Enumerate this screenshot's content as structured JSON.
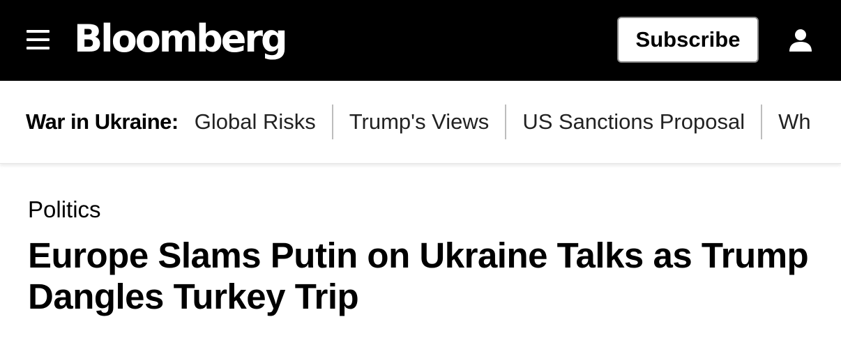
{
  "header": {
    "menu_icon": "hamburger-menu-icon",
    "logo_text": "Bloomberg",
    "subscribe_label": "Subscribe",
    "user_icon": "user-account-icon",
    "background_color": "#000000"
  },
  "nav": {
    "heading": "War in Ukraine:",
    "links": [
      {
        "label": "Global Risks"
      },
      {
        "label": "Trump's Views"
      },
      {
        "label": "US Sanctions Proposal"
      },
      {
        "label": "Wh"
      }
    ]
  },
  "article": {
    "category": "Politics",
    "headline": "Europe Slams Putin on Ukraine Talks as Trump Dangles Turkey Trip"
  }
}
